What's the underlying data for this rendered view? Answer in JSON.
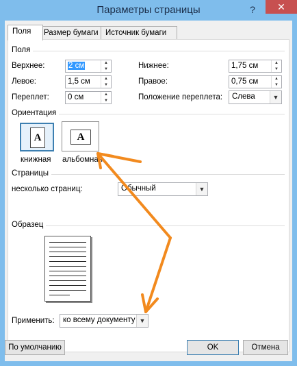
{
  "window": {
    "title": "Параметры страницы",
    "help_label": "?",
    "close_label": "✕"
  },
  "tabs": [
    {
      "label": "Поля",
      "active": true
    },
    {
      "label": "Размер бумаги",
      "active": false
    },
    {
      "label": "Источник бумаги",
      "active": false
    }
  ],
  "margins": {
    "section_label": "Поля",
    "top": {
      "label": "Верхнее:",
      "value": "2 см"
    },
    "bottom": {
      "label": "Нижнее:",
      "value": "1,75 см"
    },
    "left": {
      "label": "Левое:",
      "value": "1,5 см"
    },
    "right": {
      "label": "Правое:",
      "value": "0,75 см"
    },
    "gutter": {
      "label": "Переплет:",
      "value": "0 см"
    },
    "gutter_position": {
      "label": "Положение переплета:",
      "value": "Слева"
    }
  },
  "orientation": {
    "section_label": "Ориентация",
    "portrait": {
      "label": "книжная",
      "glyph": "A",
      "selected": true
    },
    "landscape": {
      "label": "альбомная",
      "glyph": "A",
      "selected": false
    }
  },
  "pages": {
    "section_label": "Страницы",
    "multiple_label": "несколько страниц:",
    "multiple_value": "Обычный"
  },
  "sample": {
    "section_label": "Образец"
  },
  "apply": {
    "label": "Применить:",
    "value": "ко всему документу"
  },
  "buttons": {
    "default_label": "По умолчанию",
    "ok_label": "OK",
    "cancel_label": "Отмена"
  },
  "icons": {
    "spin_up": "▲",
    "spin_down": "▼",
    "dropdown": "▼"
  },
  "colors": {
    "accent_arrow": "#f28a1e",
    "selection": "#3399ff",
    "title_bar": "#7fbdec",
    "close_button": "#c75050"
  }
}
